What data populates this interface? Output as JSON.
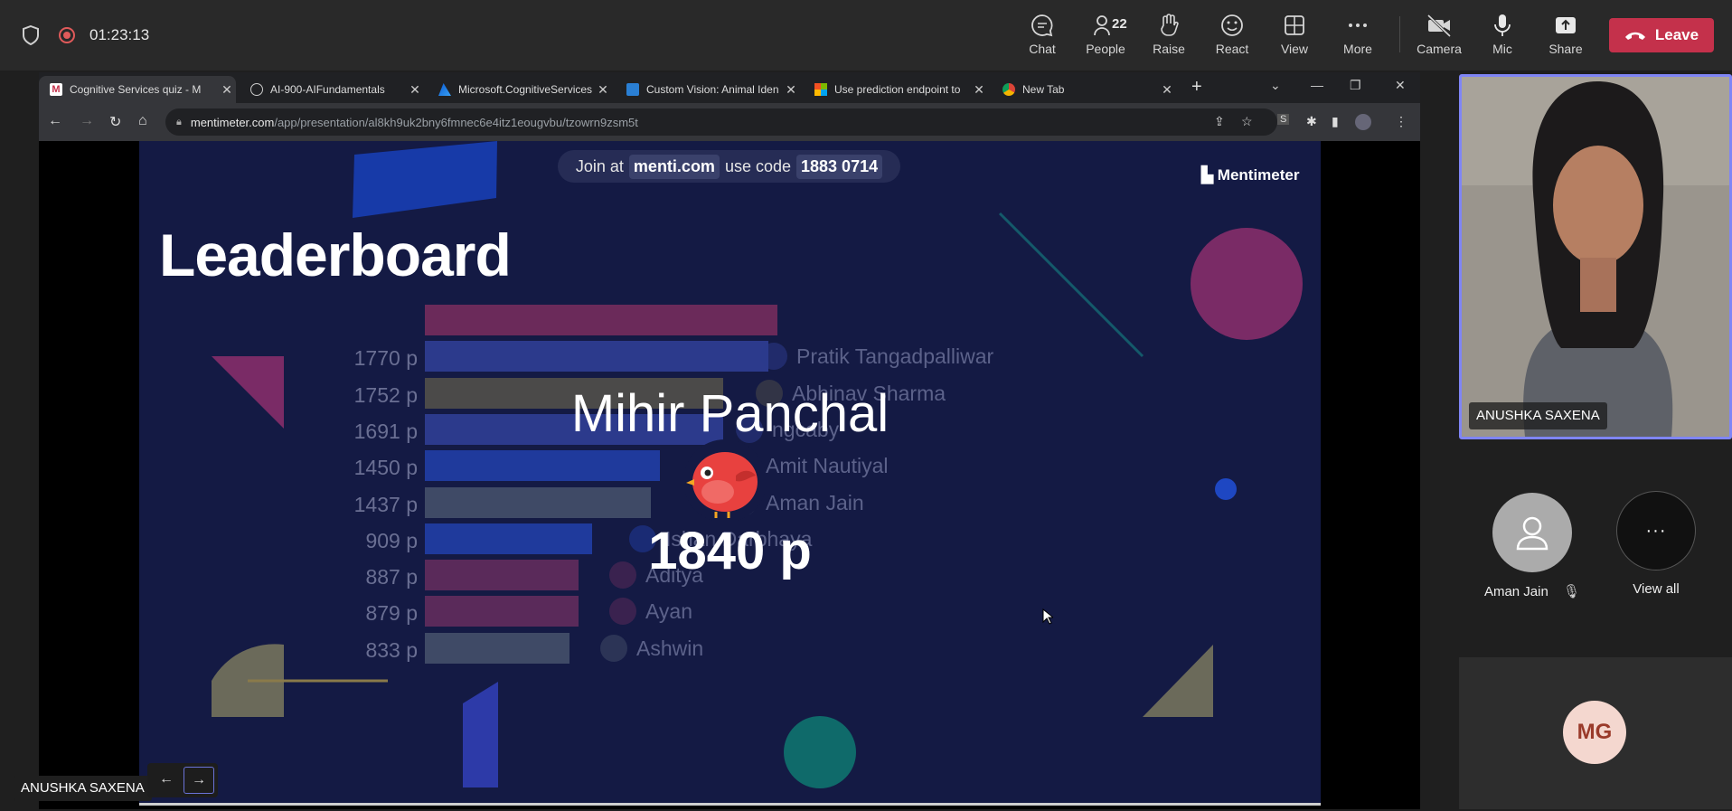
{
  "teams": {
    "timer": "01:23:13",
    "buttons": [
      {
        "key": "chat",
        "label": "Chat",
        "icon": "chat-icon"
      },
      {
        "key": "people",
        "label": "People",
        "icon": "people-icon",
        "badge": "22"
      },
      {
        "key": "raise",
        "label": "Raise",
        "icon": "raise-hand-icon"
      },
      {
        "key": "react",
        "label": "React",
        "icon": "react-icon"
      },
      {
        "key": "view",
        "label": "View",
        "icon": "view-icon"
      },
      {
        "key": "more",
        "label": "More",
        "icon": "more-icon"
      },
      {
        "key": "camera",
        "label": "Camera",
        "icon": "camera-off-icon"
      },
      {
        "key": "mic",
        "label": "Mic",
        "icon": "mic-icon"
      },
      {
        "key": "share",
        "label": "Share",
        "icon": "share-icon"
      }
    ],
    "leave_label": "Leave",
    "leave_color": "#c4314b"
  },
  "browser": {
    "tabs": [
      {
        "title": "Cognitive Services quiz - M",
        "active": true
      },
      {
        "title": "AI-900-AIFundamentals"
      },
      {
        "title": "Microsoft.CognitiveServices"
      },
      {
        "title": "Custom Vision: Animal Iden"
      },
      {
        "title": "Use prediction endpoint to"
      },
      {
        "title": "New Tab"
      }
    ],
    "url_host": "mentimeter.com",
    "url_path": "/app/presentation/al8kh9uk2bny6fmnec6e4itz1eougvbu/tzowrn9zsm5t"
  },
  "slide": {
    "join_prefix": "Join at",
    "join_site": "menti.com",
    "join_mid": "use code",
    "join_code": "1883 0714",
    "brand": "Mentimeter",
    "title": "Leaderboard",
    "winner_name": "Mihir Panchal",
    "winner_points": "1840 p",
    "rows": [
      {
        "points": "",
        "name": "",
        "color": "#6b2a5a"
      },
      {
        "points": "1770 p",
        "name": "Pratik Tangadpalliwar",
        "color": "#2c3a8c"
      },
      {
        "points": "1752 p",
        "name": "Abhinav Sharma",
        "color": "#4b4a49"
      },
      {
        "points": "1691 p",
        "name": "ngcaby",
        "color": "#2c3a8c"
      },
      {
        "points": "1450 p",
        "name": "Amit Nautiyal",
        "color": "#1f3a9c"
      },
      {
        "points": "1437 p",
        "name": "Aman Jain",
        "color": "#3f4a66"
      },
      {
        "points": "909 p",
        "name": "Ishan Darbhaya",
        "color": "#1f3a9c"
      },
      {
        "points": "887 p",
        "name": "Aditya",
        "color": "#5a2a5a"
      },
      {
        "points": "879 p",
        "name": "Ayan",
        "color": "#5a2a5a"
      },
      {
        "points": "833 p",
        "name": "Ashwin",
        "color": "#3f4a66"
      }
    ]
  },
  "presenter_name": "ANUSHKA SAXENA",
  "participants": {
    "self_name": "ANUSHKA SAXENA",
    "aman": "Aman Jain",
    "view_all": "View all",
    "mg_initials": "MG"
  }
}
